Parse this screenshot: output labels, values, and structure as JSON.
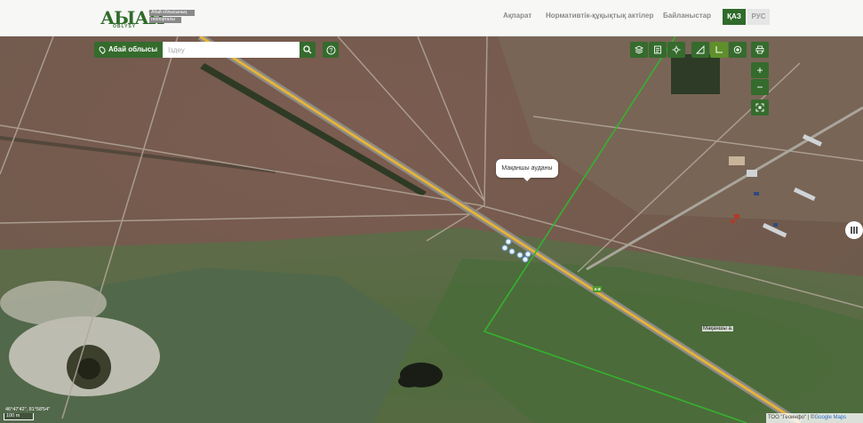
{
  "header": {
    "logo_main": "АЫАН",
    "logo_sub": "OBLYSY",
    "logo_tag_1": "Абай облысының",
    "logo_tag_2": "геопорталы",
    "nav": [
      "Ақпарат",
      "Нормативтік-құқықтық актілер",
      "Байланыстар"
    ],
    "lang_active": "ҚАЗ",
    "lang_inactive": "РУС"
  },
  "search": {
    "region_label": "Абай облысы",
    "placeholder": "Іздеу"
  },
  "map": {
    "tooltip": "Мақаншы ауданы",
    "place_label": "Мақаншы а.",
    "road_label": "A-8",
    "coords": "46°47′42″, 81°58′54″",
    "scale": "100 m",
    "attribution_company": "ТОО \"Геоинфо\"",
    "attribution_separator": " | ©",
    "attribution_provider": "Google Maps"
  },
  "toolbar": {
    "icons": [
      "layers-icon",
      "legend-icon",
      "measure-icon",
      "ruler-icon",
      "area-icon",
      "locate-icon",
      "print-icon"
    ],
    "zoom_in": "+",
    "zoom_out": "−"
  },
  "colors": {
    "brand_green": "#356b2d",
    "road_yellow": "#e5b33a",
    "boundary_green": "#35b22f"
  }
}
